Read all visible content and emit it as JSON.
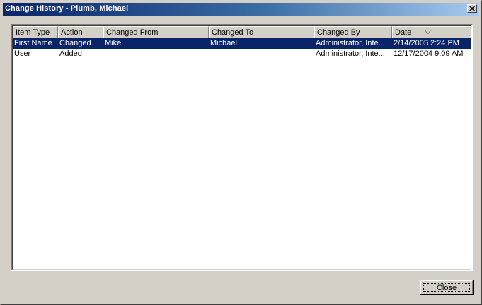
{
  "window": {
    "title": "Change History - Plumb, Michael"
  },
  "icons": {
    "close": "close-icon",
    "sort": "sort-descending-icon"
  },
  "colors": {
    "titlebar_start": "#0a246a",
    "titlebar_end": "#a6caf0",
    "selection": "#0a246a",
    "face": "#d4d0c8"
  },
  "table": {
    "columns": [
      "Item Type",
      "Action",
      "Changed From",
      "Changed To",
      "Changed By",
      "Date"
    ],
    "sorted_column": "Date",
    "rows": [
      {
        "item_type": "First Name",
        "action": "Changed",
        "changed_from": "Mike",
        "changed_to": "Michael",
        "changed_by": "Administrator, Inte...",
        "date": "2/14/2005 2:24 PM",
        "selected": true
      },
      {
        "item_type": "User",
        "action": "Added",
        "changed_from": "",
        "changed_to": "",
        "changed_by": "Administrator, Inte...",
        "date": "12/17/2004 9:09 AM",
        "selected": false
      }
    ]
  },
  "buttons": {
    "close_label": "Close"
  }
}
